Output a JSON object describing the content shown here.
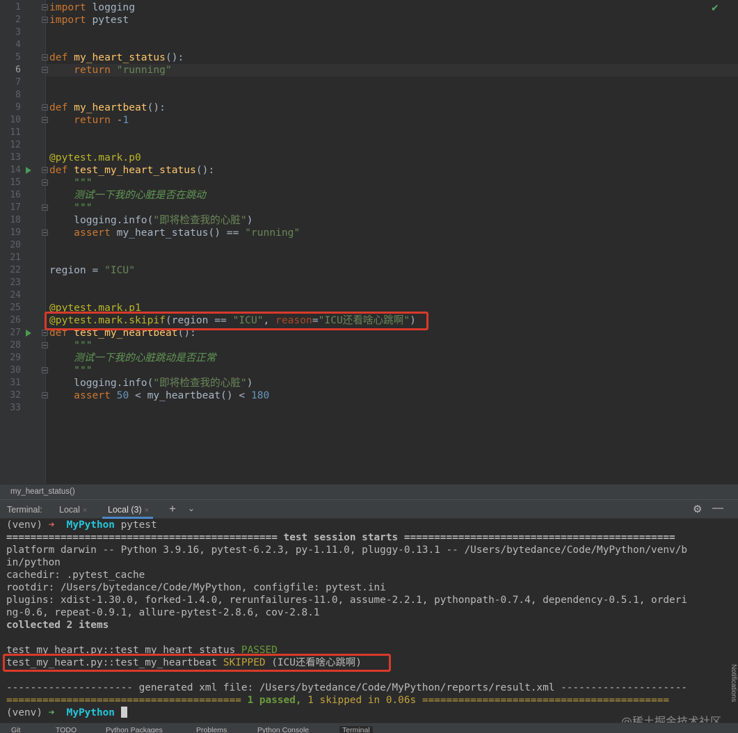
{
  "editor": {
    "line_numbers": [
      "1",
      "2",
      "3",
      "4",
      "5",
      "6",
      "7",
      "8",
      "9",
      "10",
      "11",
      "12",
      "13",
      "14",
      "15",
      "16",
      "17",
      "18",
      "19",
      "20",
      "21",
      "22",
      "23",
      "24",
      "25",
      "26",
      "27",
      "28",
      "29",
      "30",
      "31",
      "32",
      "33"
    ],
    "line1": {
      "kw": "import",
      "rest": " logging"
    },
    "line2": {
      "kw": "import",
      "rest": " pytest"
    },
    "line5": {
      "kw": "def",
      "fn": "my_heart_status",
      "rest": "():"
    },
    "line6": {
      "kw": "return",
      "str": "\"running\""
    },
    "line9": {
      "kw": "def",
      "fn": "my_heartbeat",
      "rest": "():"
    },
    "line10": {
      "kw": "return",
      "op": " -",
      "num": "1"
    },
    "line13": {
      "deco": "@pytest.mark.p0"
    },
    "line14": {
      "kw": "def",
      "fn": "test_my_heart_status",
      "rest": "():"
    },
    "line15": {
      "doc": "\"\"\""
    },
    "line16": {
      "doc": "测试一下我的心脏是否在跳动"
    },
    "line17": {
      "doc": "\"\"\""
    },
    "line18": {
      "a": "logging.info(",
      "str": "\"即将检查我的心脏\"",
      "b": ")"
    },
    "line19": {
      "kw": "assert",
      "a": " my_heart_status() == ",
      "str": "\"running\""
    },
    "line22": {
      "a": "region = ",
      "str": "\"ICU\""
    },
    "line25": {
      "deco": "@pytest.mark.p1"
    },
    "line26": {
      "deco": "@pytest.mark.skipif",
      "a": "(region == ",
      "str1": "\"ICU\"",
      "b": ", ",
      "param": "reason",
      "c": "=",
      "str2": "\"ICU还看啥心跳啊\"",
      "d": ")"
    },
    "line27": {
      "kw": "def",
      "fn": "test_my_heartbeat",
      "rest": "():"
    },
    "line28": {
      "doc": "\"\"\""
    },
    "line29": {
      "doc": "测试一下我的心脏跳动是否正常"
    },
    "line30": {
      "doc": "\"\"\""
    },
    "line31": {
      "a": "logging.info(",
      "str": "\"即将检查我的心脏\"",
      "b": ")"
    },
    "line32": {
      "kw": "assert",
      "num1": " 50",
      "a": " < my_heartbeat() < ",
      "num2": "180"
    }
  },
  "breadcrumb": "my_heart_status()",
  "terminal_header": {
    "label": "Terminal:",
    "tab1": "Local",
    "tab2": "Local (3)",
    "close": "×",
    "plus": "+",
    "chevron": "⌄",
    "gear": "⚙",
    "minimize": "—"
  },
  "terminal": {
    "prompt1_venv": "(venv)",
    "prompt1_arrow": "➜",
    "prompt1_dir": "MyPython",
    "prompt1_cmd": " pytest",
    "session_line": "============================================= test session starts =============================================",
    "platform1": "platform darwin -- Python 3.9.16, pytest-6.2.3, py-1.11.0, pluggy-0.13.1 -- /Users/bytedance/Code/MyPython/venv/b",
    "platform2": "in/python",
    "cachedir": "cachedir: .pytest_cache",
    "rootdir": "rootdir: /Users/bytedance/Code/MyPython, configfile: pytest.ini",
    "plugins1": "plugins: xdist-1.30.0, forked-1.4.0, rerunfailures-11.0, assume-2.2.1, pythonpath-0.7.4, dependency-0.5.1, orderi",
    "plugins2": "ng-0.6, repeat-0.9.1, allure-pytest-2.8.6, cov-2.8.1",
    "collected": "collected 2 items",
    "result1_name": "test_my_heart.py::test_my_heart_status ",
    "result1_status": "PASSED",
    "result2_name": "test_my_heart.py::test_my_heartbeat ",
    "result2_status": "SKIPPED",
    "result2_reason": " (ICU还看啥心跳啊)",
    "xml_line": "--------------------- generated xml file: /Users/bytedance/Code/MyPython/reports/result.xml ---------------------",
    "summary_left": "=======================================",
    "summary_passed": " 1 passed, ",
    "summary_skipped": "1 skipped",
    "summary_time": " in 0.06s ",
    "summary_right": "=========================================",
    "prompt2_venv": "(venv)",
    "prompt2_arrow": "➜",
    "prompt2_dir": "MyPython"
  },
  "side_label": "Notifications",
  "watermark": "@稀土掘金技术社区",
  "bottom_tabs": [
    "Git",
    "TODO",
    "Python Packages",
    "Problems",
    "Python Console",
    "Terminal"
  ],
  "colors": {
    "highlight_box": "#d93a2a",
    "run_marker": "#499c54",
    "active_tab_underline": "#4a88c7"
  }
}
